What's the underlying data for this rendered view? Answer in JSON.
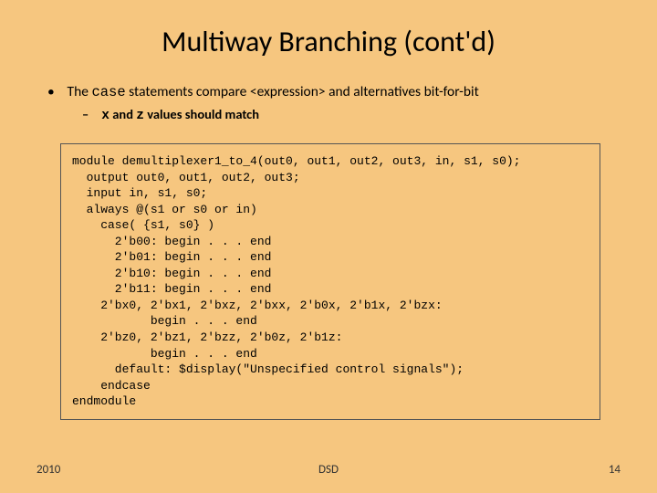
{
  "title": "Multiway Branching (cont'd)",
  "bullets": {
    "main": {
      "pre": "The ",
      "code": "case",
      "post": " statements compare <expression> and alternatives bit-for-bit"
    },
    "sub": {
      "x": "x",
      "and": " and ",
      "z": "z",
      "rest": " values should match"
    }
  },
  "code": "module demultiplexer1_to_4(out0, out1, out2, out3, in, s1, s0);\n  output out0, out1, out2, out3;\n  input in, s1, s0;\n  always @(s1 or s0 or in)\n    case( {s1, s0} )\n      2'b00: begin . . . end\n      2'b01: begin . . . end\n      2'b10: begin . . . end\n      2'b11: begin . . . end\n    2'bx0, 2'bx1, 2'bxz, 2'bxx, 2'b0x, 2'b1x, 2'bzx:\n           begin . . . end\n    2'bz0, 2'bz1, 2'bzz, 2'b0z, 2'b1z:\n           begin . . . end\n      default: $display(\"Unspecified control signals\");\n    endcase\nendmodule",
  "footer": {
    "year": "2010",
    "center": "DSD",
    "page": "14"
  }
}
